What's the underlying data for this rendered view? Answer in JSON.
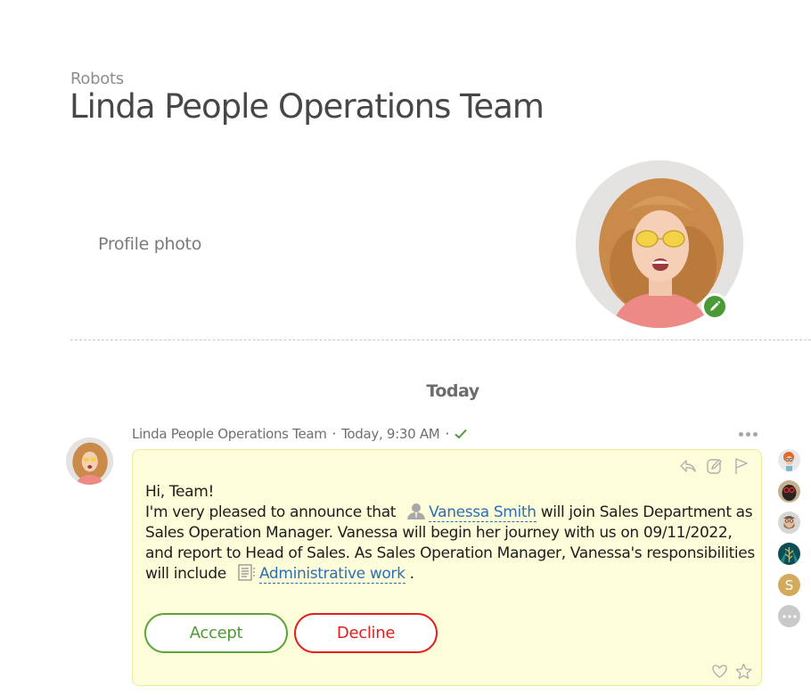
{
  "header": {
    "breadcrumb": "Robots",
    "title": "Linda People Operations Team"
  },
  "profile": {
    "label": "Profile photo",
    "photo_icon": "profile-photo-woman-yellow-glasses",
    "edit_icon": "pencil-icon",
    "edit_color": "#4a9a35"
  },
  "chat": {
    "date_separator": "Today",
    "message": {
      "sender": "Linda People Operations Team",
      "time": "Today, 9:30 AM",
      "status_icon": "check-icon",
      "greeting": "Hi, Team!",
      "text_before_mention": "I'm very pleased to announce that",
      "mention_name": "Vanessa Smith",
      "text_after_mention": "will join Sales Department as Sales Operation Manager. Vanessa will begin her journey with us on 09/11/2022, and report to Head of Sales. As Sales Operation Manager, Vanessa's responsibilities will include",
      "document_link": "Administrative work",
      "text_end": ".",
      "actions": [
        "reply-icon",
        "edit-icon",
        "flag-icon"
      ],
      "footer_actions": [
        "heart-icon",
        "star-icon"
      ],
      "buttons": {
        "accept": "Accept",
        "decline": "Decline"
      }
    },
    "participants": [
      {
        "type": "avatar",
        "name": "participant-cartoon-redhead"
      },
      {
        "type": "avatar",
        "name": "participant-pug-glasses"
      },
      {
        "type": "avatar",
        "name": "participant-bearded-man"
      },
      {
        "type": "avatar",
        "name": "participant-tropical-leaf"
      },
      {
        "type": "letter",
        "letter": "S",
        "color": "#d3a95c"
      },
      {
        "type": "more",
        "label": "•••"
      }
    ]
  }
}
